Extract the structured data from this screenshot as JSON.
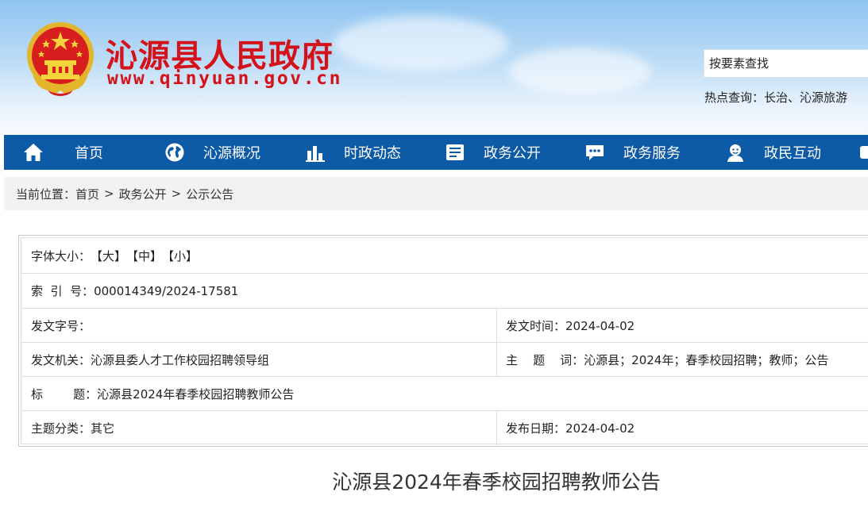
{
  "header": {
    "site_title": "沁源县人民政府",
    "site_url": "www.qinyuan.gov.cn",
    "search_placeholder": "按要素查找",
    "hot_search": "热点查询：长治、沁源旅游"
  },
  "nav": {
    "items": [
      {
        "label": "首页",
        "icon": "home-icon"
      },
      {
        "label": "沁源概况",
        "icon": "globe-icon"
      },
      {
        "label": "时政动态",
        "icon": "chart-icon"
      },
      {
        "label": "政务公开",
        "icon": "document-icon"
      },
      {
        "label": "政务服务",
        "icon": "chat-icon"
      },
      {
        "label": "政民互动",
        "icon": "user-icon"
      }
    ]
  },
  "breadcrumb": {
    "prefix": "当前位置：",
    "items": [
      "首页",
      "政务公开",
      "公示公告"
    ],
    "separator": ">"
  },
  "info": {
    "font_size_label": "字体大小：",
    "font_large": "【大】",
    "font_medium": "【中】",
    "font_small": "【小】",
    "index_no": "索  引  号：000014349/2024-17581",
    "doc_no": "发文字号：",
    "issue_time": "发文时间：2024-04-02",
    "issuer": "发文机关：沁源县委人才工作校园招聘领导组",
    "keywords": "主    题    词：沁源县；2024年；春季校园招聘；教师；公告",
    "title": "标        题：沁源县2024年春季校园招聘教师公告",
    "category": "主题分类：其它",
    "publish_date": "发布日期：2024-04-02"
  },
  "article": {
    "title": "沁源县2024年春季校园招聘教师公告"
  },
  "colors": {
    "brand_red": "#d4121a",
    "nav_blue": "#0d5aa7"
  }
}
